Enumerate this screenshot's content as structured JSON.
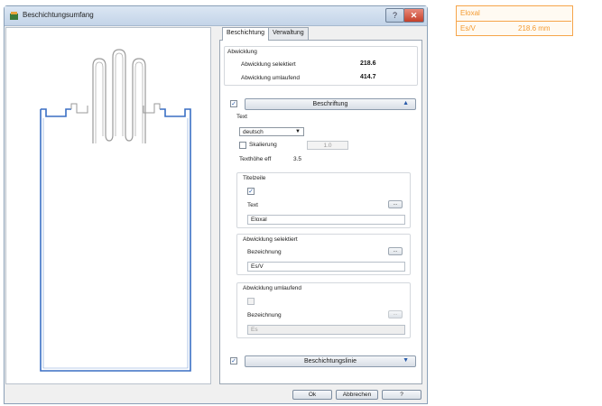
{
  "window": {
    "title": "Beschichtungsumfang",
    "help_glyph": "?",
    "close_glyph": "✕"
  },
  "tabs": [
    {
      "label": "Beschichtung",
      "active": true
    },
    {
      "label": "Verwaltung",
      "active": false
    }
  ],
  "abwicklung": {
    "title": "Abwicklung",
    "selektiert_label": "Abwicklung selektiert",
    "selektiert_value": "218.6",
    "umlaufend_label": "Abwicklung umlaufend",
    "umlaufend_value": "414.7"
  },
  "beschriftung": {
    "enabled": true,
    "header": "Beschriftung",
    "expanded_arrow": "▲",
    "text_label": "Text",
    "language": "deutsch",
    "skalierung_label": "Skalierung",
    "skalierung_checked": false,
    "skalierung_value": "1.0",
    "texthoehe_label": "Texthöhe eff",
    "texthoehe_value": "3.5",
    "titelzeile": {
      "title": "Titelzeile",
      "checked": true,
      "text_label": "Text",
      "text_value": "Eloxal",
      "button": "..."
    },
    "selektiert": {
      "title": "Abwicklung selektiert",
      "label": "Bezeichnung",
      "value": "Es/V",
      "button": "..."
    },
    "umlaufend": {
      "title": "Abwicklung umlaufend",
      "checked": false,
      "label": "Bezeichnung",
      "value": "Es",
      "button": "..."
    }
  },
  "beschichtungslinie": {
    "enabled": true,
    "header": "Beschichtungslinie",
    "arrow": "▼"
  },
  "buttons": {
    "ok": "Ok",
    "cancel": "Abbrechen",
    "help": "?"
  },
  "label_preview": {
    "line1": "Eloxal",
    "line2_left": "Es/V",
    "line2_right": "218.6  mm",
    "color": "#f49a30"
  },
  "colors": {
    "profile_line": "#3a6fc4",
    "drawing_line": "#9a9a9a",
    "accent": "#f49a30"
  }
}
